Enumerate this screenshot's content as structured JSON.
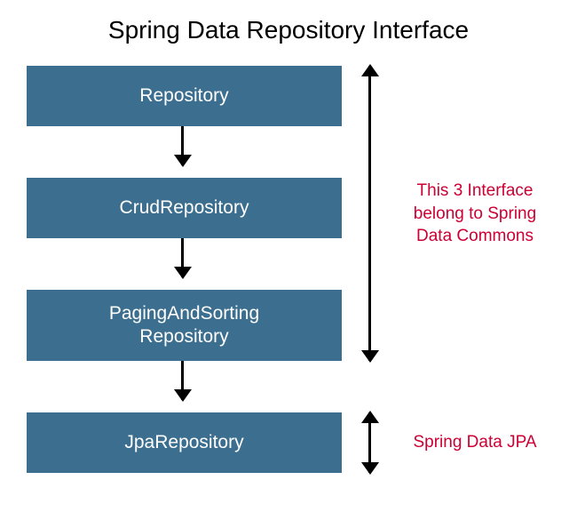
{
  "title": "Spring Data Repository Interface",
  "boxes": {
    "b1": "Repository",
    "b2": "CrudRepository",
    "b3_line1": "PagingAndSorting",
    "b3_line2": "Repository",
    "b4": "JpaRepository"
  },
  "annotations": {
    "a1_line1": "This 3 Interface",
    "a1_line2": "belong to Spring",
    "a1_line3": "Data Commons",
    "a2": "Spring Data JPA"
  }
}
